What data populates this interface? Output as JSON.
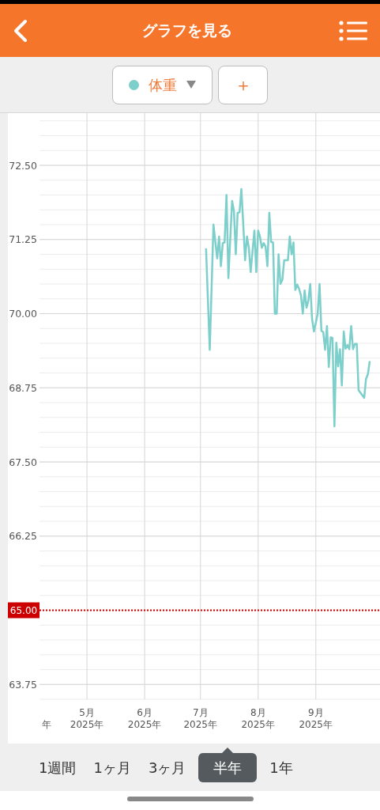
{
  "header": {
    "title": "グラフを見る"
  },
  "toolbar": {
    "add_button": {
      "label": "＋"
    }
  },
  "chart": {
    "cut_tick_label": "年",
    "chart_data": {
      "type": "line",
      "categories": [
        null,
        null,
        null,
        null,
        null,
        null,
        null,
        null,
        null,
        null,
        null,
        null,
        null,
        null,
        null,
        null,
        null,
        null,
        null,
        null,
        null,
        null,
        null,
        null,
        null,
        "5月\n2025年",
        null,
        null,
        null,
        null,
        null,
        null,
        null,
        null,
        null,
        null,
        null,
        null,
        null,
        null,
        null,
        null,
        null,
        null,
        null,
        null,
        null,
        null,
        null,
        null,
        null,
        null,
        null,
        null,
        null,
        null,
        "6月\n2025年",
        null,
        null,
        null,
        null,
        null,
        null,
        null,
        null,
        null,
        null,
        null,
        null,
        null,
        null,
        null,
        null,
        null,
        null,
        null,
        null,
        null,
        null,
        null,
        null,
        null,
        null,
        null,
        null,
        null,
        "7月\n2025年",
        null,
        null,
        null,
        null,
        null,
        null,
        null,
        null,
        null,
        null,
        null,
        null,
        null,
        null,
        null,
        null,
        null,
        null,
        null,
        null,
        null,
        null,
        null,
        null,
        null,
        null,
        null,
        null,
        null,
        null,
        "8月\n2025年",
        null,
        null,
        null,
        null,
        null,
        null,
        null,
        null,
        null,
        null,
        null,
        null,
        null,
        null,
        null,
        null,
        null,
        null,
        null,
        null,
        null,
        null,
        null,
        null,
        null,
        null,
        null,
        null,
        null,
        null,
        "9月\n2025年",
        null,
        null,
        null,
        null,
        null,
        null,
        null,
        null,
        null,
        null,
        null,
        null,
        null,
        null,
        null,
        null,
        null,
        null,
        null,
        null,
        null,
        null,
        null,
        null,
        null,
        null,
        null,
        null,
        null,
        null,
        null,
        null,
        null,
        null
      ],
      "series": [
        {
          "name": "体重",
          "color": "#7ccfca",
          "values": [
            null,
            null,
            null,
            null,
            null,
            null,
            null,
            null,
            null,
            null,
            null,
            null,
            null,
            null,
            null,
            null,
            null,
            null,
            null,
            null,
            null,
            null,
            null,
            null,
            null,
            null,
            null,
            null,
            null,
            null,
            null,
            null,
            null,
            null,
            null,
            null,
            null,
            null,
            null,
            null,
            null,
            null,
            null,
            null,
            null,
            null,
            null,
            null,
            null,
            null,
            null,
            null,
            null,
            null,
            null,
            null,
            null,
            null,
            null,
            null,
            null,
            null,
            null,
            null,
            null,
            null,
            null,
            null,
            null,
            null,
            null,
            null,
            null,
            null,
            null,
            null,
            null,
            null,
            null,
            null,
            null,
            null,
            null,
            null,
            null,
            null,
            null,
            null,
            null,
            71.1,
            null,
            69.39,
            null,
            71.5,
            null,
            70.93,
            71.3,
            70.8,
            71.19,
            71.2,
            72.0,
            70.6,
            null,
            71.9,
            71.73,
            71.0,
            71.7,
            71.71,
            72.1,
            71.51,
            70.9,
            71.3,
            71.11,
            70.7,
            null,
            71.4,
            70.7,
            71.4,
            71.3,
            71.11,
            71.19,
            71.13,
            70.8,
            71.7,
            71.21,
            71.2,
            70.0,
            70.0,
            71.0,
            70.5,
            70.57,
            70.9,
            null,
            70.9,
            71.3,
            71.0,
            71.2,
            70.4,
            70.49,
            70.42,
            70.31,
            70.0,
            70.39,
            70.1,
            70.22,
            70.5,
            69.91,
            69.7,
            69.84,
            70.0,
            70.5,
            69.71,
            69.69,
            69.39,
            69.79,
            69.1,
            69.6,
            69.59,
            68.1,
            69.51,
            69.11,
            69.4,
            68.79,
            69.7,
            69.41,
            69.47,
            69.4,
            69.79,
            69.4,
            69.49,
            69.49,
            68.71,
            null,
            null,
            68.58,
            68.9,
            68.98,
            69.2,
            null,
            null,
            null,
            null,
            null
          ]
        }
      ],
      "ylim": [
        63.5,
        73.3
      ],
      "yticks": [
        {
          "value": 72.5,
          "label": "72.50"
        },
        {
          "value": 71.25,
          "label": "71.25"
        },
        {
          "value": 70,
          "label": "70.00"
        },
        {
          "value": 68.75,
          "label": "68.75"
        },
        {
          "value": 67.5,
          "label": "67.50"
        },
        {
          "value": 66.25,
          "label": "66.25"
        },
        {
          "value": 63.75,
          "label": "63.75"
        }
      ],
      "grid": true,
      "ref_lines": [
        {
          "axis": "y",
          "value": 65,
          "label": "65.00",
          "color": "#cc0000"
        }
      ]
    }
  },
  "periods": [
    {
      "label": "1週間",
      "selected": false
    },
    {
      "label": "1ヶ月",
      "selected": false
    },
    {
      "label": "3ヶ月",
      "selected": false
    },
    {
      "label": "半年",
      "selected": true
    },
    {
      "label": "1年",
      "selected": false
    }
  ]
}
